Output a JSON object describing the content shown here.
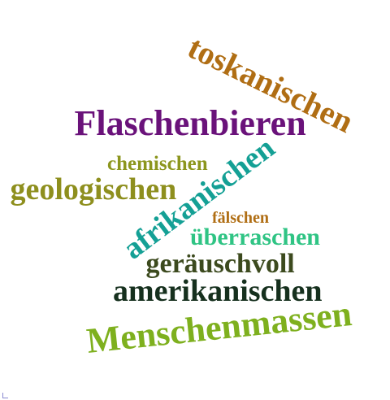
{
  "cloud": {
    "words": {
      "toskanischen": {
        "text": "toskanischen",
        "color": "#b06e14"
      },
      "flaschenbieren": {
        "text": "Flaschenbieren",
        "color": "#6a127a"
      },
      "chemischen": {
        "text": "chemischen",
        "color": "#8c961e"
      },
      "afrikanischen": {
        "text": "afrikanischen",
        "color": "#14a095"
      },
      "geologischen": {
        "text": "geologischen",
        "color": "#8e8f1e"
      },
      "faelschen": {
        "text": "fälschen",
        "color": "#b06e14"
      },
      "ueberraschen": {
        "text": "überraschen",
        "color": "#2fc484"
      },
      "geraeuschvoll": {
        "text": "geräuschvoll",
        "color": "#3c4a1e"
      },
      "amerikanischen": {
        "text": "amerikanischen",
        "color": "#16301e"
      },
      "menschenmassen": {
        "text": "Menschenmassen",
        "color": "#7eb01e"
      }
    }
  }
}
